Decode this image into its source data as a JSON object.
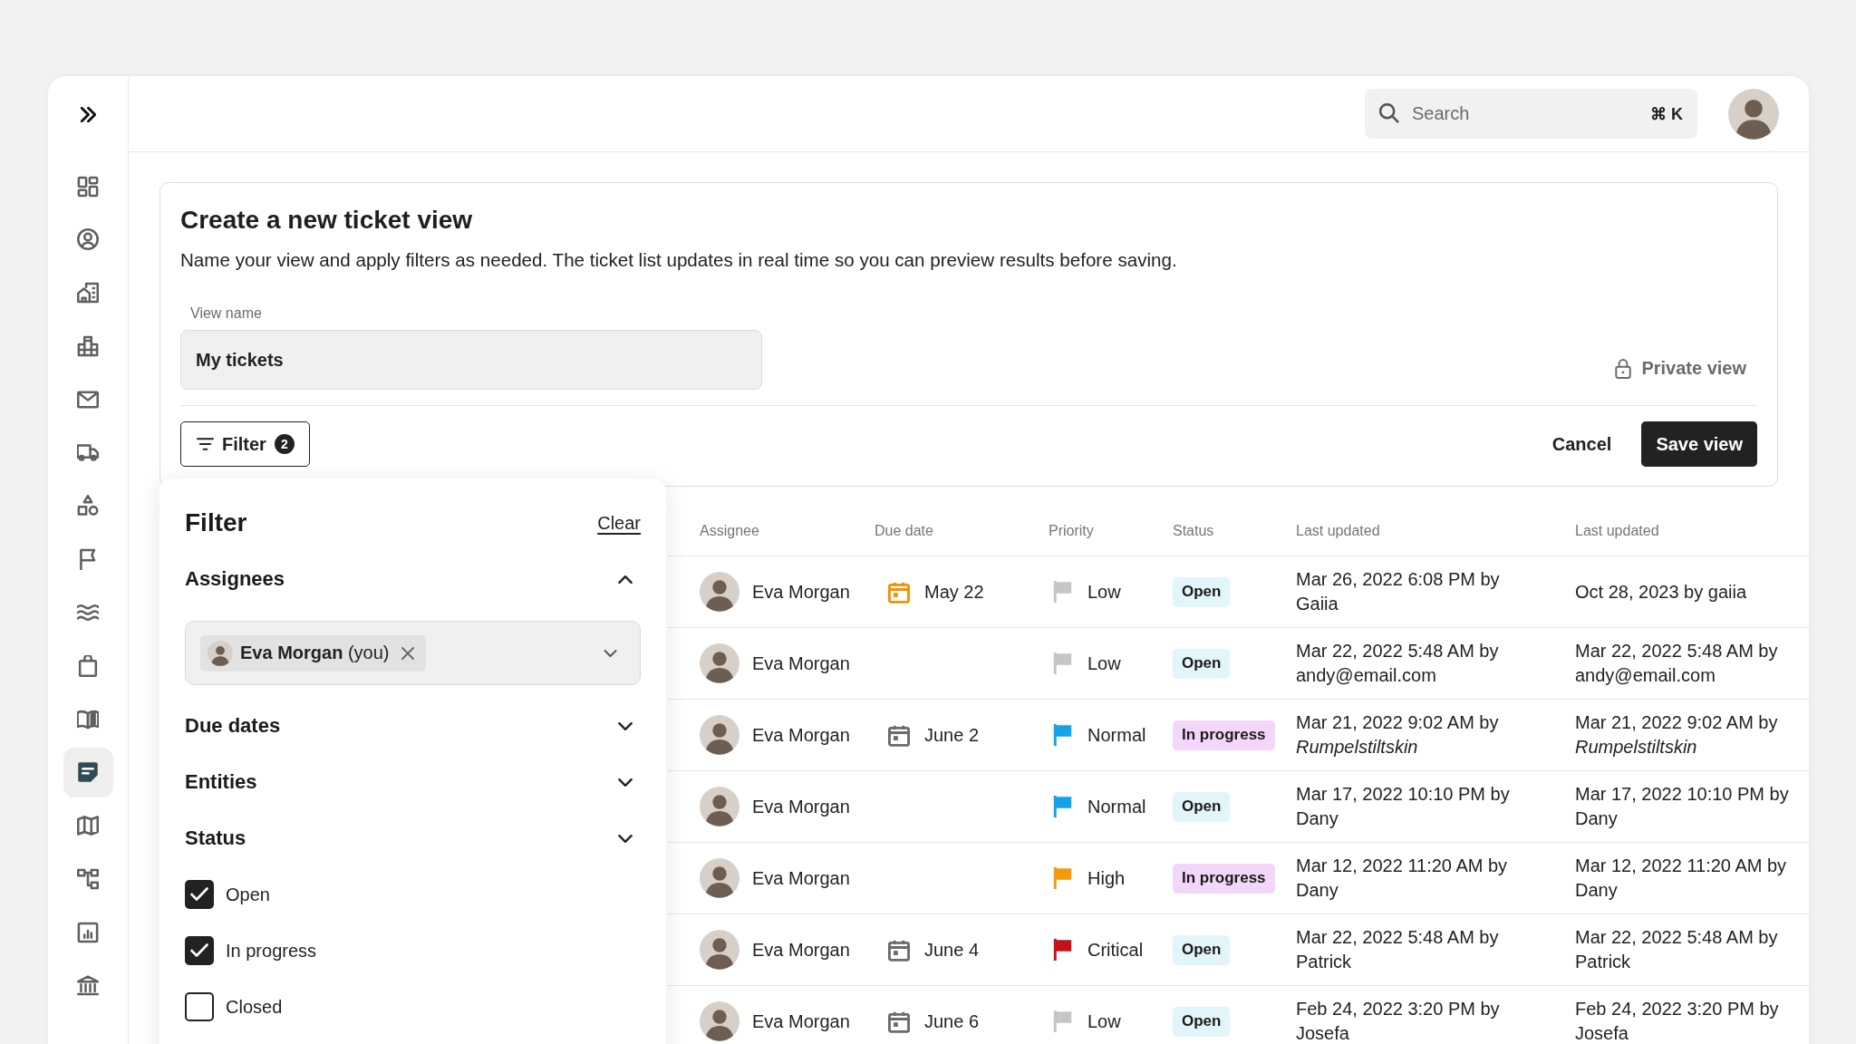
{
  "sidebar": {
    "items": [
      {
        "kind": "grid",
        "selected": false
      },
      {
        "kind": "person",
        "selected": false
      },
      {
        "kind": "house",
        "selected": false
      },
      {
        "kind": "buildings",
        "selected": false
      },
      {
        "kind": "mail",
        "selected": false
      },
      {
        "kind": "truck",
        "selected": false
      },
      {
        "kind": "shapes",
        "selected": false
      },
      {
        "kind": "flag",
        "selected": false
      },
      {
        "kind": "waves",
        "selected": false
      },
      {
        "kind": "bag",
        "selected": false
      },
      {
        "kind": "book",
        "selected": false
      },
      {
        "kind": "note",
        "selected": true
      },
      {
        "kind": "map",
        "selected": false
      },
      {
        "kind": "hierarchy",
        "selected": false
      },
      {
        "kind": "chart",
        "selected": false
      },
      {
        "kind": "bank",
        "selected": false
      }
    ]
  },
  "header": {
    "search": {
      "placeholder": "Search",
      "shortcut": "⌘ K"
    }
  },
  "form": {
    "title": "Create a new ticket view",
    "description": "Name your view and apply filters as needed. The ticket list updates in real time so you can preview results before saving.",
    "view_name": {
      "label": "View name",
      "value": "My tickets"
    },
    "private_view": {
      "label": "Private view"
    },
    "filter_button": {
      "label": "Filter",
      "count": "2"
    },
    "buttons": [
      {
        "label": "Cancel",
        "kind": "text"
      },
      {
        "label": "Save view",
        "kind": "primary"
      }
    ]
  },
  "filter_panel": {
    "title": "Filter",
    "clear": "Clear",
    "sections": [
      {
        "title": "Assignees",
        "expanded": true,
        "chips": [
          {
            "label": "**Eva Morgan** (you)"
          }
        ]
      },
      {
        "title": "Due dates",
        "expanded": false
      },
      {
        "title": "Entities",
        "expanded": false
      },
      {
        "title": "Status",
        "expanded": false,
        "options": [
          {
            "label": "Open",
            "checked": true
          },
          {
            "label": "In progress",
            "checked": true
          },
          {
            "label": "Closed",
            "checked": false
          }
        ]
      }
    ]
  },
  "table": {
    "columns": [
      "Assignee",
      "Due date",
      "Priority",
      "Status",
      "Last updated",
      "Last updated"
    ],
    "rows": [
      {
        "assignee": "Eva Morgan",
        "due": {
          "date": "May 22",
          "color": "#f29200"
        },
        "priority": {
          "label": "Low",
          "color": "#c6c6c6"
        },
        "status": {
          "label": "Open",
          "color": "#e2f5fa"
        },
        "last_updated": "Mar 26, 2022 6:08 PM by Gaiia",
        "last_updated_2": "Oct 28, 2023 by gaiia"
      },
      {
        "assignee": "Eva Morgan",
        "priority": {
          "label": "Low",
          "color": "#c6c6c6"
        },
        "status": {
          "label": "Open",
          "color": "#e2f5fa"
        },
        "last_updated": "Mar 22, 2022 5:48 AM by andy@email.com",
        "last_updated_2": "Mar 22, 2022 5:48 AM by andy@email.com"
      },
      {
        "assignee": "Eva Morgan",
        "due": {
          "date": "June 2",
          "color": "#6b6b6b"
        },
        "priority": {
          "label": "Normal",
          "color": "#13a4e8"
        },
        "status": {
          "label": "In progress",
          "color": "#f3d7fa"
        },
        "last_updated": "Mar 21, 2022 9:02 AM by *Rumpelstiltskin*",
        "last_updated_2": "Mar 21, 2022 9:02 AM by *Rumpelstiltskin*"
      },
      {
        "assignee": "Eva Morgan",
        "priority": {
          "label": "Normal",
          "color": "#13a4e8"
        },
        "status": {
          "label": "Open",
          "color": "#e2f5fa"
        },
        "last_updated": "Mar 17, 2022 10:10 PM by Dany",
        "last_updated_2": "Mar 17, 2022 10:10 PM by Dany"
      },
      {
        "assignee": "Eva Morgan",
        "priority": {
          "label": "High",
          "color": "#f59a0c"
        },
        "status": {
          "label": "In progress",
          "color": "#f3d7fa"
        },
        "last_updated": "Mar 12, 2022 11:20 AM by Dany",
        "last_updated_2": "Mar 12, 2022 11:20 AM by Dany"
      },
      {
        "assignee": "Eva Morgan",
        "due": {
          "date": "June 4",
          "color": "#6b6b6b"
        },
        "priority": {
          "label": "Critical",
          "color": "#c4121a"
        },
        "status": {
          "label": "Open",
          "color": "#e2f5fa"
        },
        "last_updated": "Mar 22, 2022 5:48 AM by Patrick",
        "last_updated_2": "Mar 22, 2022 5:48 AM by Patrick"
      },
      {
        "assignee": "Eva Morgan",
        "due": {
          "date": "June 6",
          "color": "#6b6b6b"
        },
        "priority": {
          "label": "Low",
          "color": "#c6c6c6"
        },
        "status": {
          "label": "Open",
          "color": "#e2f5fa"
        },
        "last_updated": "Feb 24, 2022 3:20 PM by Josefa",
        "last_updated_2": "Feb 24, 2022 3:20 PM by Josefa"
      }
    ]
  }
}
